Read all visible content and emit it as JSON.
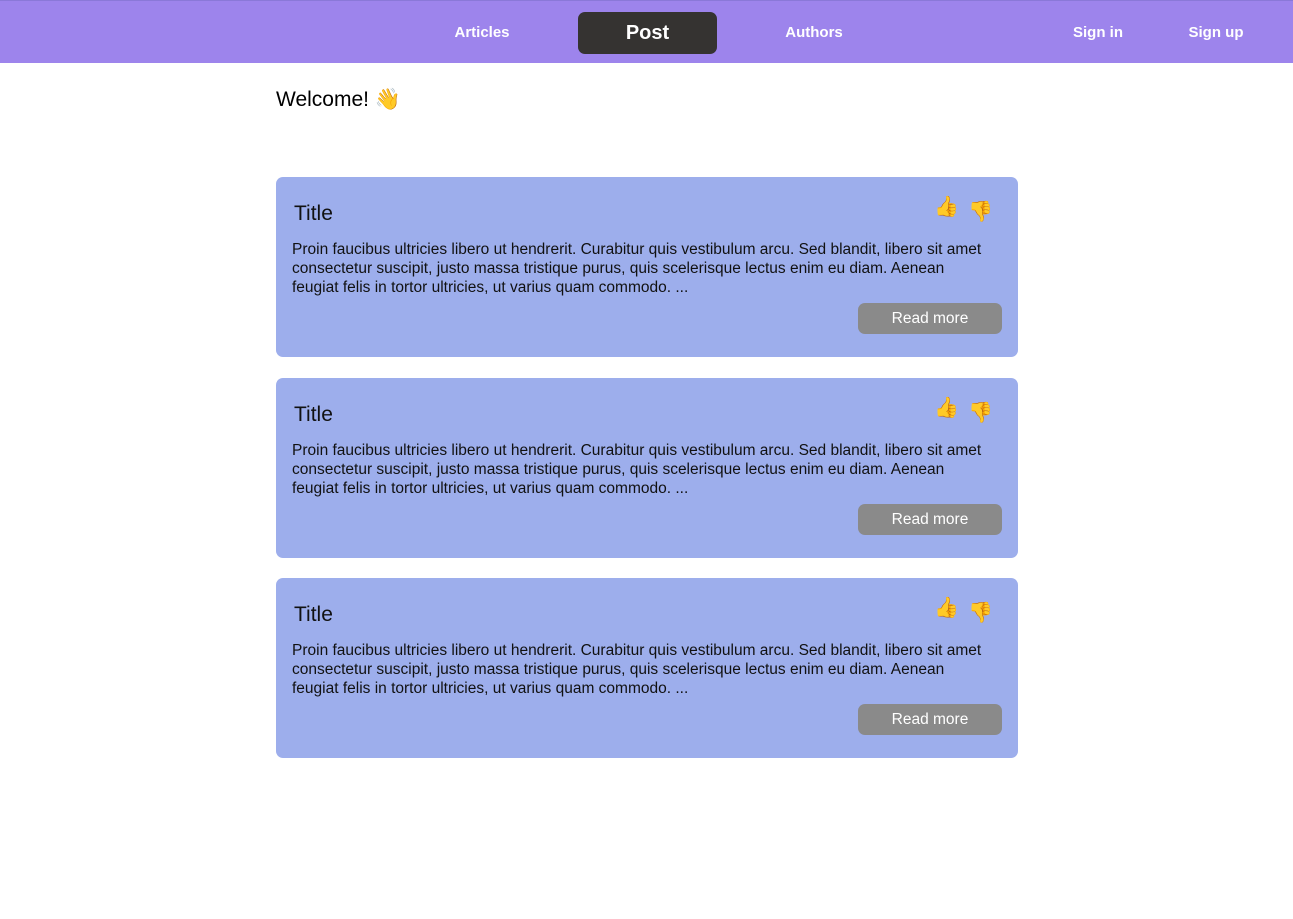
{
  "nav": {
    "articles": "Articles",
    "post": "Post",
    "authors": "Authors",
    "sign_in": "Sign in",
    "sign_up": "Sign up"
  },
  "welcome": {
    "text": "Welcome!",
    "emoji": "👋"
  },
  "thumbs": {
    "up": "👍",
    "down": "👎"
  },
  "cards": [
    {
      "title": "Title",
      "body": "Proin faucibus ultricies libero ut hendrerit. Curabitur quis vestibulum arcu. Sed blandit, libero sit amet consectetur suscipit, justo massa tristique purus, quis scelerisque lectus enim eu diam. Aenean feugiat felis in tortor ultricies, ut varius quam commodo. ...",
      "button": "Read more"
    },
    {
      "title": "Title",
      "body": "Proin faucibus ultricies libero ut hendrerit. Curabitur quis vestibulum arcu. Sed blandit, libero sit amet consectetur suscipit, justo massa tristique purus, quis scelerisque lectus enim eu diam. Aenean feugiat felis in tortor ultricies, ut varius quam commodo. ...",
      "button": "Read more"
    },
    {
      "title": "Title",
      "body": "Proin faucibus ultricies libero ut hendrerit. Curabitur quis vestibulum arcu. Sed blandit, libero sit amet consectetur suscipit, justo massa tristique purus, quis scelerisque lectus enim eu diam. Aenean feugiat felis in tortor ultricies, ut varius quam commodo. ...",
      "button": "Read more"
    }
  ],
  "colors": {
    "navbar": "#9d84ec",
    "active_tab": "#353331",
    "card": "#9daeec",
    "button": "#8a8a8a"
  }
}
